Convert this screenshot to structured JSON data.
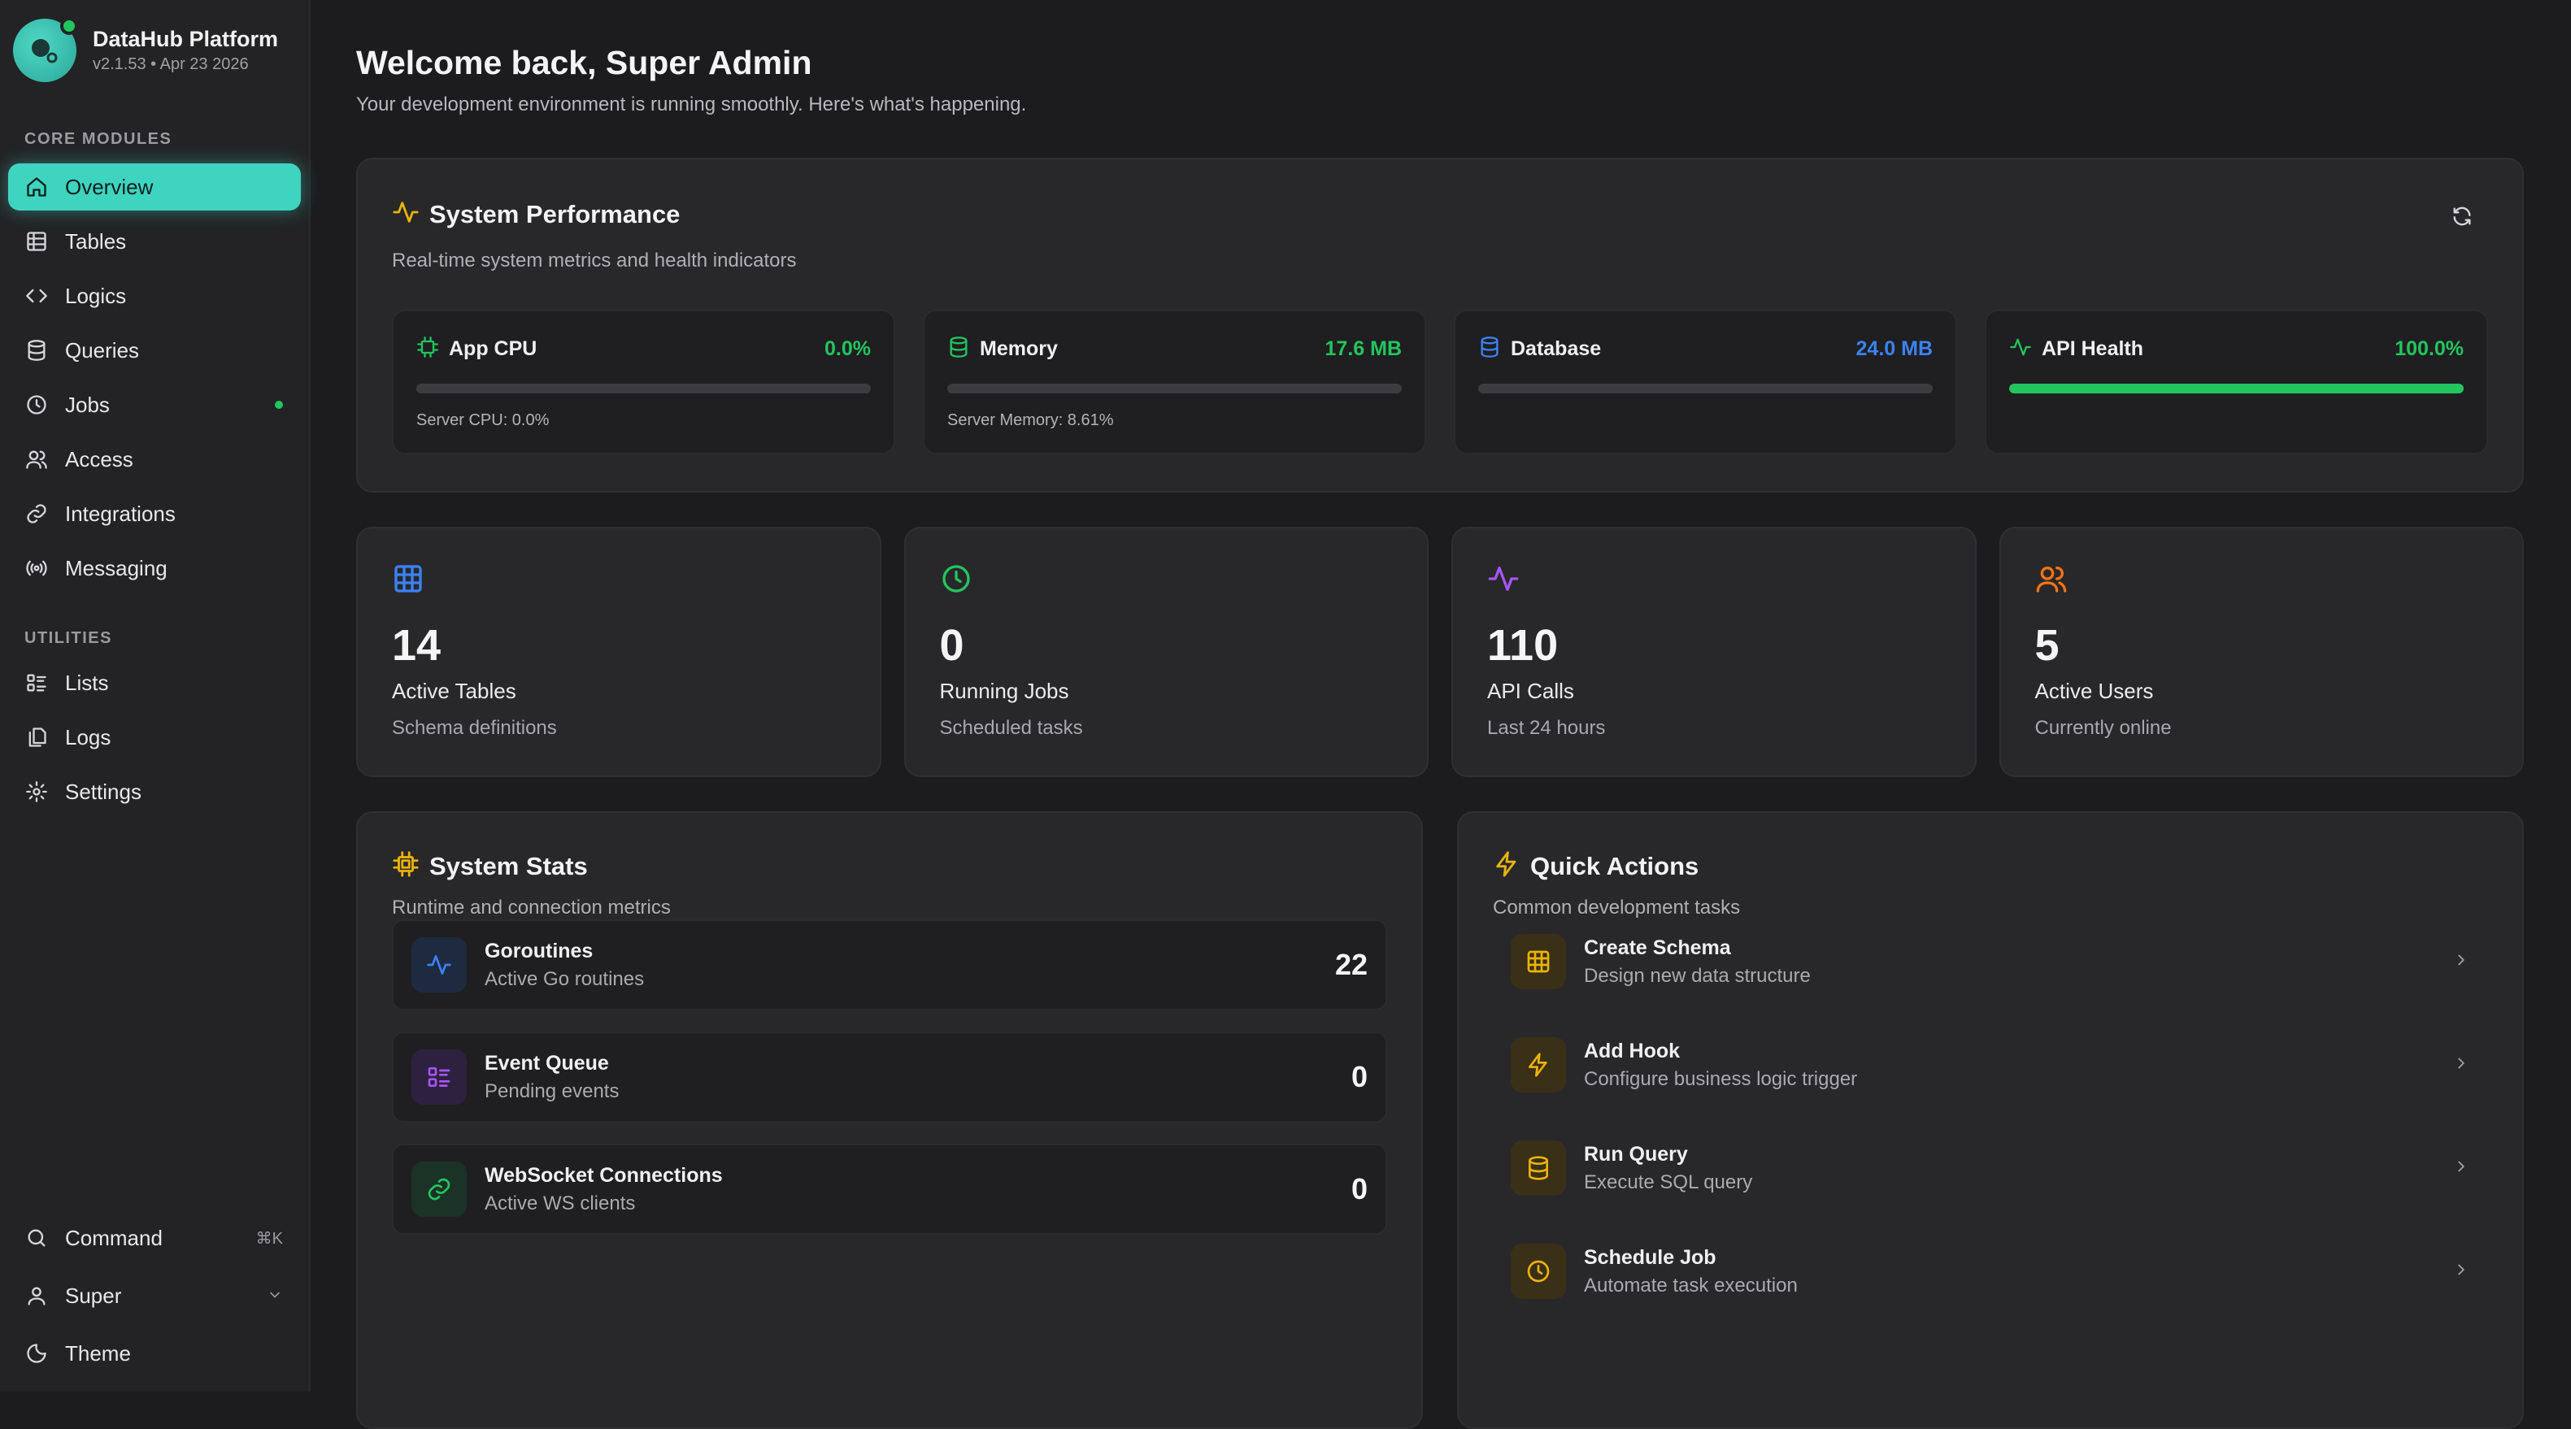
{
  "brand": {
    "name": "DataHub Platform",
    "version": "v2.1.53 • Apr 23 2026"
  },
  "sidebar": {
    "core_title": "CORE MODULES",
    "core": [
      {
        "label": "Overview",
        "icon": "home-icon",
        "active": true
      },
      {
        "label": "Tables",
        "icon": "table-icon"
      },
      {
        "label": "Logics",
        "icon": "code-icon"
      },
      {
        "label": "Queries",
        "icon": "database-icon"
      },
      {
        "label": "Jobs",
        "icon": "clock-icon",
        "status_dot": true
      },
      {
        "label": "Access",
        "icon": "users-icon"
      },
      {
        "label": "Integrations",
        "icon": "link-icon"
      },
      {
        "label": "Messaging",
        "icon": "radio-icon"
      }
    ],
    "utilities_title": "UTILITIES",
    "utilities": [
      {
        "label": "Lists",
        "icon": "list-icon"
      },
      {
        "label": "Logs",
        "icon": "files-icon"
      },
      {
        "label": "Settings",
        "icon": "gear-icon"
      }
    ],
    "footer": {
      "command_label": "Command",
      "command_shortcut": "⌘K",
      "user_label": "Super",
      "theme_label": "Theme"
    }
  },
  "header": {
    "title": "Welcome back, Super Admin",
    "subtitle": "Your development environment is running smoothly. Here's what's happening."
  },
  "performance": {
    "title": "System Performance",
    "description": "Real-time system metrics and health indicators",
    "metrics": [
      {
        "name": "App CPU",
        "value": "0.0%",
        "value_color": "#22c55e",
        "fill_fraction": 0.0,
        "note": "Server CPU: 0.0%"
      },
      {
        "name": "Memory",
        "value": "17.6 MB",
        "value_color": "#22c55e",
        "fill_fraction": 0.0,
        "note": "Server Memory: 8.61%"
      },
      {
        "name": "Database",
        "value": "24.0 MB",
        "value_color": "#3b82f6",
        "fill_fraction": 0.0,
        "note": ""
      },
      {
        "name": "API Health",
        "value": "100.0%",
        "value_color": "#22c55e",
        "fill_fraction": 1.0,
        "note": ""
      }
    ]
  },
  "stats": [
    {
      "value": "14",
      "label": "Active Tables",
      "sub": "Schema definitions",
      "icon": "table-icon",
      "color": "#3b82f6"
    },
    {
      "value": "0",
      "label": "Running Jobs",
      "sub": "Scheduled tasks",
      "icon": "clock-icon",
      "color": "#22c55e"
    },
    {
      "value": "110",
      "label": "API Calls",
      "sub": "Last 24 hours",
      "icon": "activity-icon",
      "color": "#a855f7"
    },
    {
      "value": "5",
      "label": "Active Users",
      "sub": "Currently online",
      "icon": "users-icon",
      "color": "#f97316"
    }
  ],
  "system_stats": {
    "title": "System Stats",
    "description": "Runtime and connection metrics",
    "rows": [
      {
        "name": "Goroutines",
        "sub": "Active Go routines",
        "value": "22"
      },
      {
        "name": "Event Queue",
        "sub": "Pending events",
        "value": "0"
      },
      {
        "name": "WebSocket Connections",
        "sub": "Active WS clients",
        "value": "0"
      }
    ]
  },
  "quick_actions": {
    "title": "Quick Actions",
    "description": "Common development tasks",
    "items": [
      {
        "name": "Create Schema",
        "sub": "Design new data structure",
        "icon": "table-icon"
      },
      {
        "name": "Add Hook",
        "sub": "Configure business logic trigger",
        "icon": "bolt-icon"
      },
      {
        "name": "Run Query",
        "sub": "Execute SQL query",
        "icon": "database-icon"
      },
      {
        "name": "Schedule Job",
        "sub": "Automate task execution",
        "icon": "clock-icon"
      }
    ]
  }
}
